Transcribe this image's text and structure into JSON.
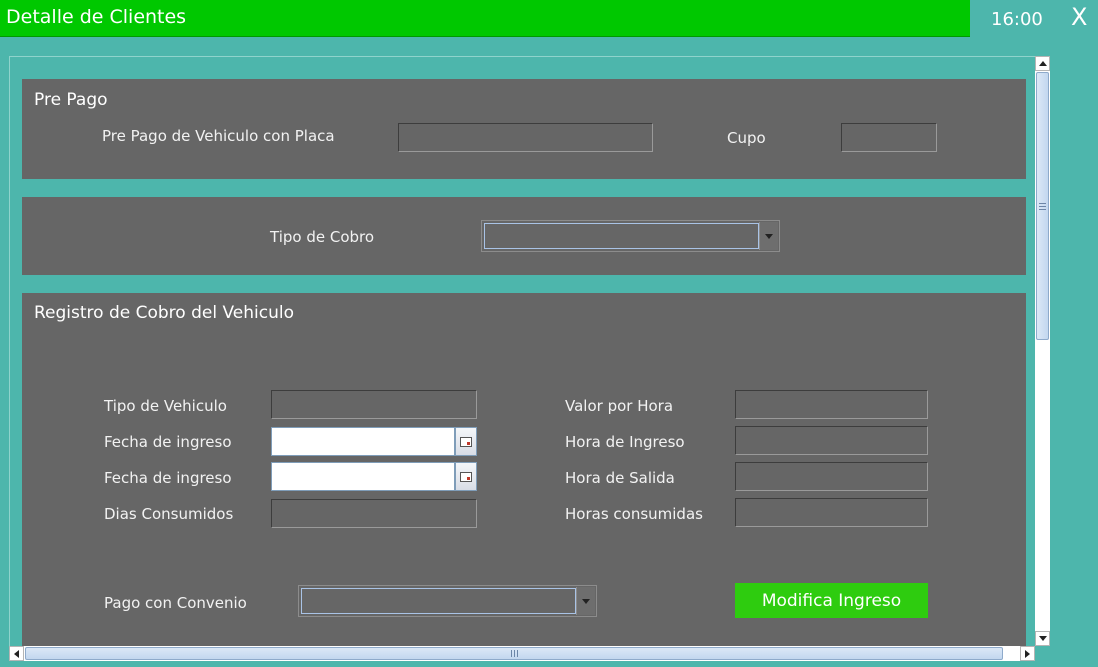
{
  "window": {
    "title": "Detalle de Clientes",
    "clock": "16:00",
    "close_label": "X"
  },
  "pre_pago": {
    "title": "Pre Pago",
    "placa_label": "Pre Pago de Vehiculo con Placa",
    "placa_value": "",
    "cupo_label": "Cupo",
    "cupo_value": ""
  },
  "tipo_cobro": {
    "label": "Tipo de Cobro",
    "selected": ""
  },
  "registro": {
    "title": "Registro de Cobro del Vehiculo",
    "tipo_vehiculo_label": "Tipo de Vehiculo",
    "tipo_vehiculo_value": "",
    "fecha_ingreso_label": "Fecha de ingreso",
    "fecha_ingreso_value": "",
    "fecha_ingreso2_label": "Fecha de ingreso",
    "fecha_ingreso2_value": "",
    "dias_consumidos_label": "Dias Consumidos",
    "dias_consumidos_value": "",
    "valor_hora_label": "Valor por Hora",
    "valor_hora_value": "",
    "hora_ingreso_label": "Hora de Ingreso",
    "hora_ingreso_value": "",
    "hora_salida_label": "Hora de Salida",
    "hora_salida_value": "",
    "horas_consumidas_label": "Horas consumidas",
    "horas_consumidas_value": "",
    "pago_convenio_label": "Pago con Convenio",
    "pago_convenio_selected": "",
    "modifica_button": "Modifica Ingreso"
  },
  "icons": {
    "calendar": "calendar-icon",
    "dropdown": "chevron-down-icon",
    "close": "close-icon"
  },
  "colors": {
    "title_bar": "#00c800",
    "background": "#4db6ac",
    "panel": "#666666",
    "button": "#2ecc0f"
  }
}
